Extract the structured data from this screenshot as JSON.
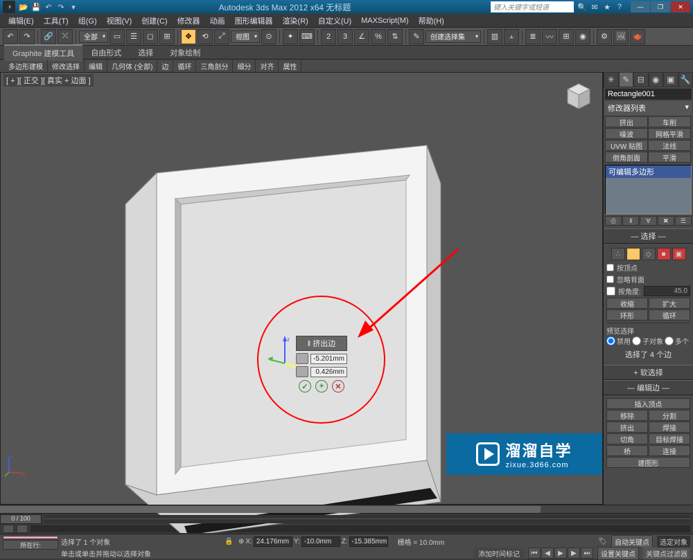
{
  "titlebar": {
    "app_title": "Autodesk 3ds Max 2012 x64   无标题",
    "search_placeholder": "键入关键字或短语"
  },
  "menus": [
    "编辑(E)",
    "工具(T)",
    "组(G)",
    "视图(V)",
    "创建(C)",
    "修改器",
    "动画",
    "图形编辑器",
    "渲染(R)",
    "自定义(U)",
    "MAXScript(M)",
    "帮助(H)"
  ],
  "toolbar": {
    "all_dropdown": "全部",
    "view_dropdown": "视图",
    "selset_dropdown": "创建选择集"
  },
  "ribbon": {
    "tabs": [
      "Graphite 建模工具",
      "自由形式",
      "选择",
      "对象绘制"
    ],
    "sub": [
      "多边形建模",
      "修改选择",
      "编辑",
      "几何体 (全部)",
      "边",
      "循环",
      "三角剖分",
      "细分",
      "对齐",
      "属性"
    ]
  },
  "viewport": {
    "label": "[ + ][ 正交 ][ 真实 + 边面 ]"
  },
  "caddy": {
    "title": "‖ 挤出边",
    "height": "-5.201mm",
    "width": "0.426mm"
  },
  "cmdpanel": {
    "object_name": "Rectangle001",
    "modifier_list": "修改器列表",
    "mod_buttons": [
      "挤出",
      "车削",
      "噪波",
      "网格平滑",
      "UVW 贴图",
      "法线",
      "倒角剖面",
      "平滑"
    ],
    "stack_item": "可编辑多边形",
    "rollouts": {
      "selection": "选择",
      "by_vertex": "按顶点",
      "ignore_backfacing": "忽略背面",
      "by_angle": "按角度:",
      "angle_val": "45.0",
      "shrink": "收缩",
      "grow": "扩大",
      "ring": "环形",
      "loop": "循环",
      "preview_sel": "预览选择",
      "off": "禁用",
      "subobj": "子对象",
      "multi": "多个",
      "selected_text": "选择了 4 个边",
      "soft_sel": "软选择",
      "edit_edges": "编辑边",
      "insert_vertex": "插入顶点",
      "remove": "移除",
      "split": "分割",
      "extrude": "挤出",
      "weld": "焊接",
      "chamfer": "切角",
      "target_weld": "目标焊接",
      "bridge": "桥",
      "connect": "连接",
      "create_shape": "建图形"
    }
  },
  "timeline": {
    "frame": "0 / 100"
  },
  "status": {
    "sel_msg": "选择了 1 个对象",
    "click_msg": "单击或单击并拖动以选择对象",
    "x": "24.176mm",
    "y": "-10.0mm",
    "z": "-15.385mm",
    "grid": "栅格 = 10.0mm",
    "add_time_tag": "添加时间标记",
    "auto_key": "自动关键点",
    "sel_target": "选定对象",
    "set_key": "设置关键点",
    "key_filter": "关键点过滤器",
    "current_row": "所在行:"
  },
  "watermark": {
    "big": "溜溜自学",
    "small": "zixue.3d66.com"
  }
}
